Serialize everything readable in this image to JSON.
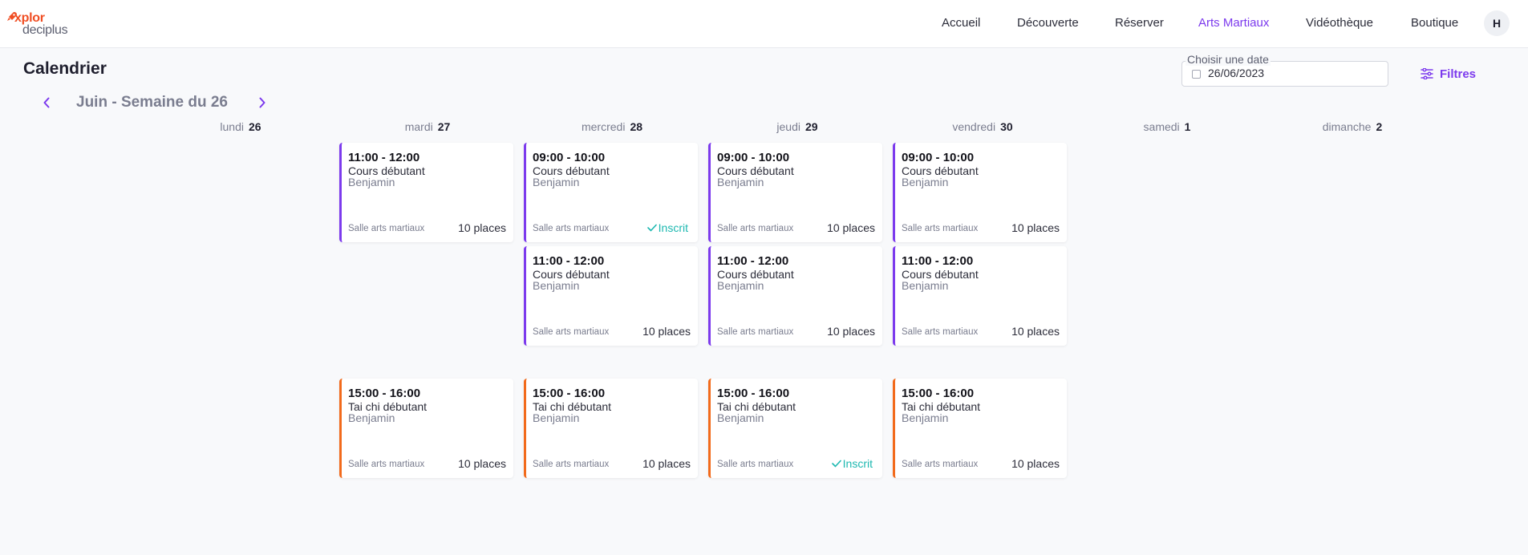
{
  "brand": {
    "line1": "xplor",
    "line2": "deciplus",
    "accent": "#f04e23"
  },
  "nav": {
    "items": [
      "Accueil",
      "Découverte",
      "Réserver",
      "Arts Martiaux",
      "Vidéothèque",
      "Boutique"
    ],
    "active": "Arts Martiaux",
    "avatar": "H"
  },
  "page": {
    "title": "Calendrier"
  },
  "date_picker": {
    "label": "Choisir une date",
    "value": "26/06/2023",
    "icon": "calendar-icon"
  },
  "filters": {
    "label": "Filtres",
    "icon": "sliders-icon"
  },
  "week": {
    "label": "Juin - Semaine du 26",
    "prev_icon": "chevron-left-icon",
    "next_icon": "chevron-right-icon"
  },
  "days": [
    {
      "name": "lundi",
      "num": "26"
    },
    {
      "name": "mardi",
      "num": "27"
    },
    {
      "name": "mercredi",
      "num": "28"
    },
    {
      "name": "jeudi",
      "num": "29"
    },
    {
      "name": "vendredi",
      "num": "30"
    },
    {
      "name": "samedi",
      "num": "1"
    },
    {
      "name": "dimanche",
      "num": "2"
    }
  ],
  "colors": {
    "purple": "#7c3aed",
    "orange": "#f26a1b",
    "registered": "#1cb8b0"
  },
  "events": [
    {
      "time": "11:00 - 12:00",
      "course": "Cours débutant",
      "coach": "Benjamin",
      "room": "Salle arts martiaux",
      "places": "10 places",
      "status": ""
    },
    {
      "time": "09:00 - 10:00",
      "course": "Cours débutant",
      "coach": "Benjamin",
      "room": "Salle arts martiaux",
      "places": "",
      "status": "Inscrit"
    },
    {
      "time": "09:00 - 10:00",
      "course": "Cours débutant",
      "coach": "Benjamin",
      "room": "Salle arts martiaux",
      "places": "10 places",
      "status": ""
    },
    {
      "time": "09:00 - 10:00",
      "course": "Cours débutant",
      "coach": "Benjamin",
      "room": "Salle arts martiaux",
      "places": "10 places",
      "status": ""
    },
    {
      "time": "11:00 - 12:00",
      "course": "Cours débutant",
      "coach": "Benjamin",
      "room": "Salle arts martiaux",
      "places": "10 places",
      "status": ""
    },
    {
      "time": "11:00 - 12:00",
      "course": "Cours débutant",
      "coach": "Benjamin",
      "room": "Salle arts martiaux",
      "places": "10 places",
      "status": ""
    },
    {
      "time": "11:00 - 12:00",
      "course": "Cours débutant",
      "coach": "Benjamin",
      "room": "Salle arts martiaux",
      "places": "10 places",
      "status": ""
    },
    {
      "time": "15:00 - 16:00",
      "course": "Tai chi débutant",
      "coach": "Benjamin",
      "room": "Salle arts martiaux",
      "places": "10 places",
      "status": ""
    },
    {
      "time": "15:00 - 16:00",
      "course": "Tai chi débutant",
      "coach": "Benjamin",
      "room": "Salle arts martiaux",
      "places": "10 places",
      "status": ""
    },
    {
      "time": "15:00 - 16:00",
      "course": "Tai chi débutant",
      "coach": "Benjamin",
      "room": "Salle arts martiaux",
      "places": "",
      "status": "Inscrit"
    },
    {
      "time": "15:00 - 16:00",
      "course": "Tai chi débutant",
      "coach": "Benjamin",
      "room": "Salle arts martiaux",
      "places": "10 places",
      "status": ""
    }
  ]
}
